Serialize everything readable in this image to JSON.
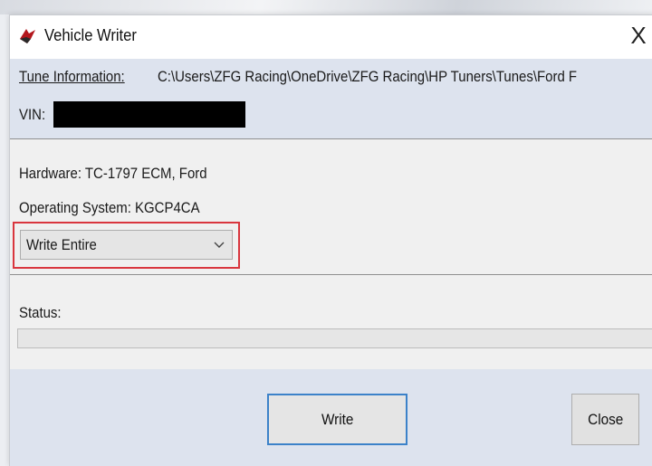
{
  "window": {
    "title": "Vehicle Writer",
    "close_glyph": "X",
    "app_icon": "hp-tuners-logo-icon"
  },
  "tune_info": {
    "label": "Tune Information:",
    "path": "C:\\Users\\ZFG Racing\\OneDrive\\ZFG Racing\\HP Tuners\\Tunes\\Ford F",
    "vin_label": "VIN:",
    "vin_value_redacted": true
  },
  "hardware": {
    "hardware_line": "Hardware: TC-1797 ECM, Ford",
    "os_line": "Operating System: KGCP4CA"
  },
  "write_mode": {
    "selected": "Write Entire",
    "highlight_color": "#d9363e"
  },
  "status": {
    "label": "Status:",
    "progress": 0
  },
  "buttons": {
    "write_label": "Write",
    "close_label": "Close"
  },
  "colors": {
    "panel_blue": "#dde3ee",
    "focus_blue": "#3c82c9"
  }
}
